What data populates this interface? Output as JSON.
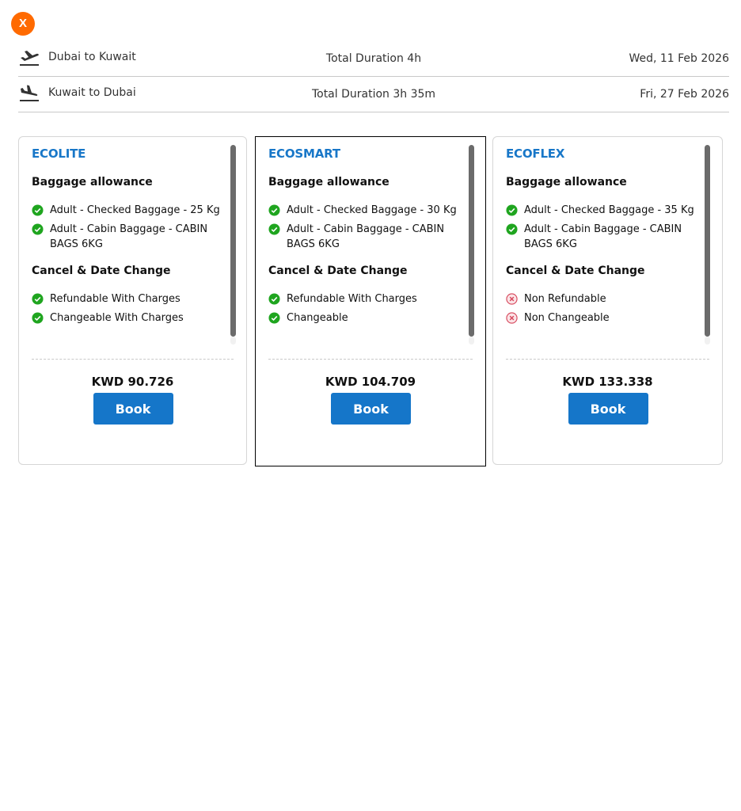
{
  "close_button": {
    "label": "X",
    "color": "#ff6a00"
  },
  "legs": [
    {
      "icon": "takeoff-plane-icon",
      "route": "Dubai to Kuwait",
      "duration": "Total Duration 4h",
      "date": "Wed, 11 Feb 2026"
    },
    {
      "icon": "landing-plane-icon",
      "route": "Kuwait to Dubai",
      "duration": "Total Duration 3h 35m",
      "date": "Fri, 27 Feb 2026"
    }
  ],
  "fares": [
    {
      "name": "ECOLITE",
      "selected": false,
      "baggage_title": "Baggage allowance",
      "baggage": [
        {
          "text": "Adult - Checked Baggage - 25 Kg",
          "status": "included"
        },
        {
          "text": "Adult - Cabin Baggage - CABIN BAGS 6KG",
          "status": "included"
        }
      ],
      "change_title": "Cancel & Date Change",
      "changes": [
        {
          "text": "Refundable With Charges",
          "status": "included"
        },
        {
          "text": "Changeable With Charges",
          "status": "included"
        }
      ],
      "price": "KWD 90.726",
      "book_label": "Book"
    },
    {
      "name": "ECOSMART",
      "selected": true,
      "baggage_title": "Baggage allowance",
      "baggage": [
        {
          "text": "Adult - Checked Baggage - 30 Kg",
          "status": "included"
        },
        {
          "text": "Adult - Cabin Baggage - CABIN BAGS 6KG",
          "status": "included"
        }
      ],
      "change_title": "Cancel & Date Change",
      "changes": [
        {
          "text": "Refundable With Charges",
          "status": "included"
        },
        {
          "text": "Changeable",
          "status": "included"
        }
      ],
      "price": "KWD 104.709",
      "book_label": "Book"
    },
    {
      "name": "ECOFLEX",
      "selected": false,
      "baggage_title": "Baggage allowance",
      "baggage": [
        {
          "text": "Adult - Checked Baggage - 35 Kg",
          "status": "included"
        },
        {
          "text": "Adult - Cabin Baggage - CABIN BAGS 6KG",
          "status": "included"
        }
      ],
      "change_title": "Cancel & Date Change",
      "changes": [
        {
          "text": "Non Refundable",
          "status": "excluded"
        },
        {
          "text": "Non Changeable",
          "status": "excluded"
        }
      ],
      "price": "KWD 133.338",
      "book_label": "Book"
    }
  ],
  "colors": {
    "fare_name": "#1877c8",
    "book_button": "#1576c9",
    "included": "#1fa51f",
    "excluded": "#d6455a"
  }
}
